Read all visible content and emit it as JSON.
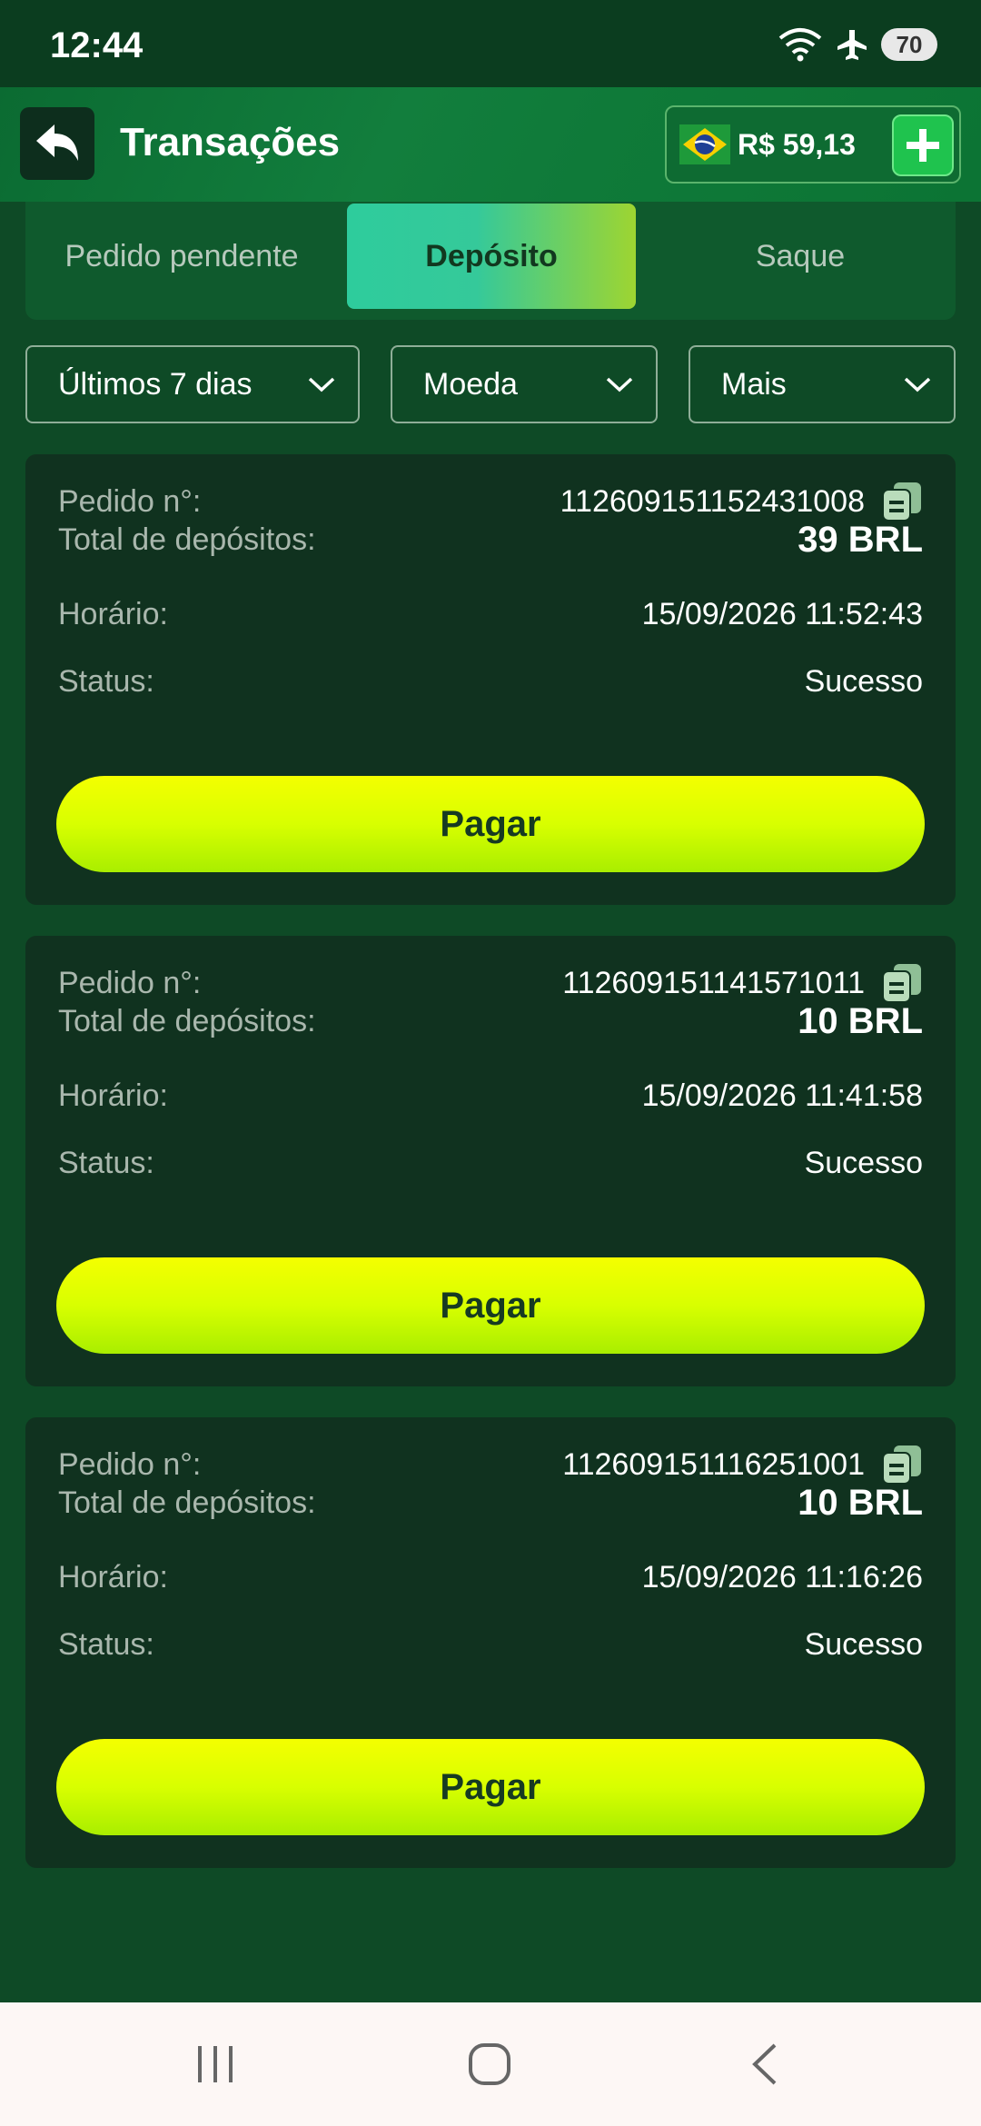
{
  "status_bar": {
    "time": "12:44",
    "battery": "70",
    "icons": [
      "wifi-icon",
      "airplane-icon",
      "battery-icon"
    ]
  },
  "header": {
    "title": "Transações",
    "balance": "R$ 59,13",
    "icons": [
      "back-arrow-icon",
      "brazil-flag-icon",
      "plus-icon"
    ]
  },
  "tabs": [
    {
      "label": "Pedido pendente",
      "active": false
    },
    {
      "label": "Depósito",
      "active": true
    },
    {
      "label": "Saque",
      "active": false
    }
  ],
  "filters": [
    {
      "label": "Últimos 7 dias"
    },
    {
      "label": "Moeda"
    },
    {
      "label": "Mais"
    }
  ],
  "labels": {
    "order": "Pedido n°:",
    "total": "Total de depósitos:",
    "time": "Horário:",
    "status": "Status:"
  },
  "transactions": [
    {
      "order_no": "112609151152431008",
      "total": "39 BRL",
      "time": "15/09/2026 11:52:43",
      "status": "Sucesso",
      "action": "Pagar"
    },
    {
      "order_no": "112609151141571011",
      "total": "10 BRL",
      "time": "15/09/2026 11:41:58",
      "status": "Sucesso",
      "action": "Pagar"
    },
    {
      "order_no": "112609151116251001",
      "total": "10 BRL",
      "time": "15/09/2026 11:16:26",
      "status": "Sucesso",
      "action": "Pagar"
    }
  ],
  "nav": [
    "recent-apps-icon",
    "home-icon",
    "back-icon"
  ],
  "colors": {
    "background": "#0e4a26",
    "card": "#10321f",
    "accent_button": "#d8ff00",
    "active_tab_start": "#2ecc9c",
    "active_tab_end": "#9ed531"
  }
}
